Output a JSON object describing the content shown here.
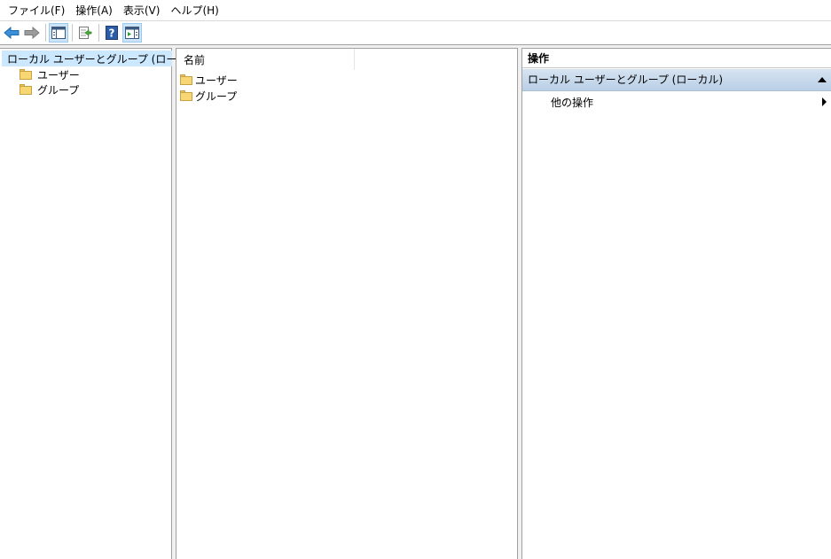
{
  "menu": {
    "items": [
      "ファイル(F)",
      "操作(A)",
      "表示(V)",
      "ヘルプ(H)"
    ]
  },
  "toolbar": {
    "buttons": [
      "back-arrow-icon",
      "forward-arrow-icon",
      "show-hide-console-tree-icon",
      "export-list-icon",
      "help-icon",
      "show-hide-action-pane-icon"
    ]
  },
  "tree": {
    "root": "ローカル ユーザーとグループ (ローカル)",
    "children": [
      "ユーザー",
      "グループ"
    ]
  },
  "list": {
    "column_header": "名前",
    "items": [
      "ユーザー",
      "グループ"
    ]
  },
  "actions": {
    "title": "操作",
    "section": "ローカル ユーザーとグループ (ローカル)",
    "item": "他の操作"
  },
  "colors": {
    "selection": "#cce8ff",
    "section_header": "#b9cfe6",
    "folder": "#f7d774"
  }
}
